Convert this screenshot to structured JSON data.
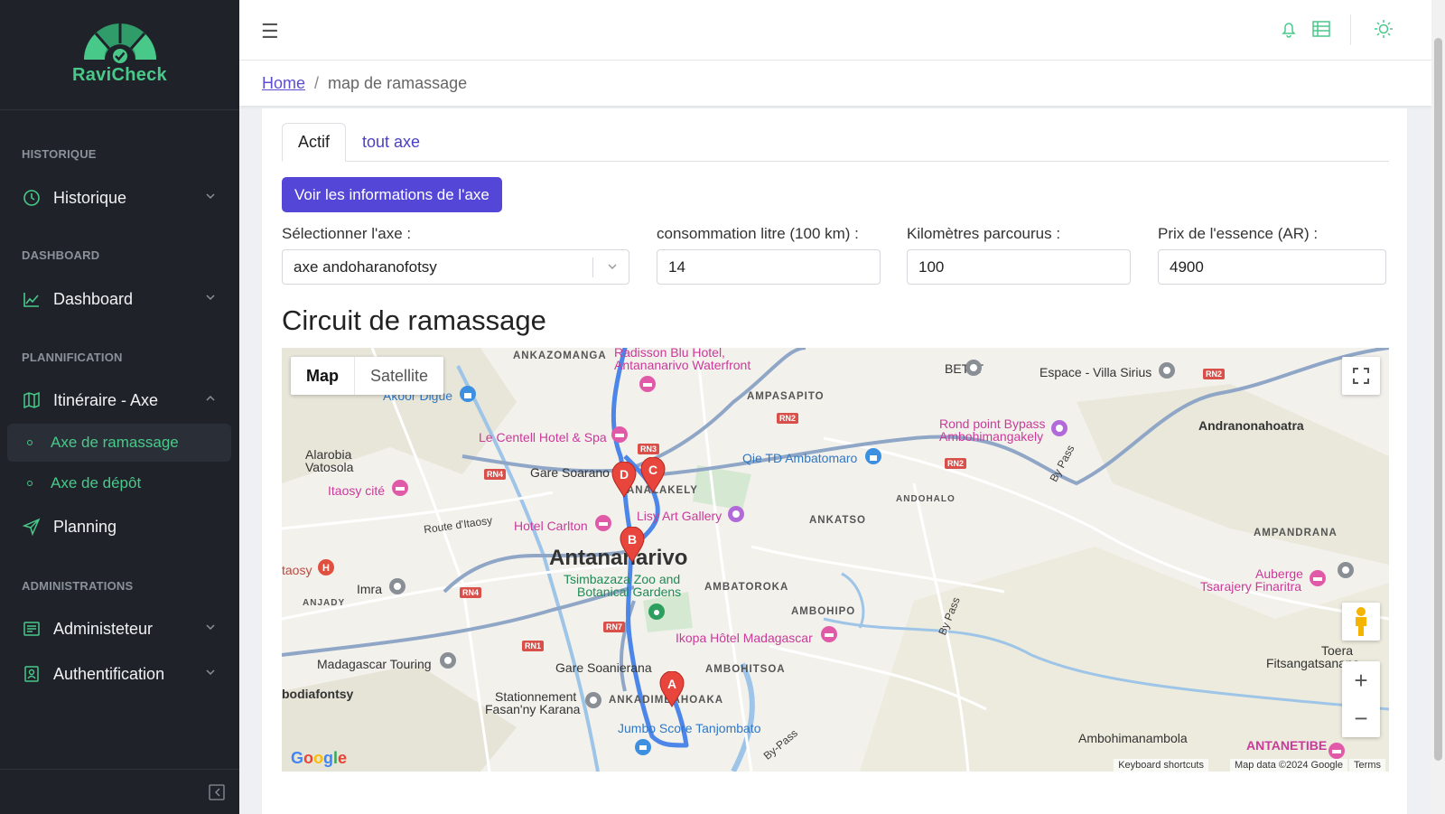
{
  "app": {
    "name": "RaviCheck",
    "brand_color": "#48c98a",
    "accent_color": "#5446d6"
  },
  "sidebar": {
    "sections": [
      {
        "title": "HISTORIQUE",
        "items": [
          {
            "label": "Historique",
            "icon": "history-icon",
            "expanded": false
          }
        ]
      },
      {
        "title": "DASHBOARD",
        "items": [
          {
            "label": "Dashboard",
            "icon": "chart-line-icon",
            "expanded": false
          }
        ]
      },
      {
        "title": "PLANNIFICATION",
        "items": [
          {
            "label": "Itinéraire - Axe",
            "icon": "map-icon",
            "expanded": true,
            "children": [
              {
                "label": "Axe de ramassage",
                "active": true
              },
              {
                "label": "Axe de dépôt",
                "active": false
              }
            ]
          },
          {
            "label": "Planning",
            "icon": "send-icon"
          }
        ]
      },
      {
        "title": "ADMINISTRATIONS",
        "items": [
          {
            "label": "Administeteur",
            "icon": "list-icon",
            "expanded": false
          },
          {
            "label": "Authentification",
            "icon": "user-doc-icon",
            "expanded": false
          }
        ]
      }
    ]
  },
  "header": {
    "icons": [
      "menu-icon",
      "bell-icon",
      "table-icon",
      "sun-icon"
    ]
  },
  "breadcrumb": {
    "home": "Home",
    "separator": "/",
    "current": "map de ramassage"
  },
  "tabs": [
    {
      "label": "Actif",
      "active": true
    },
    {
      "label": "tout axe",
      "active": false
    }
  ],
  "main": {
    "info_button": "Voir les informations de l'axe",
    "fields": {
      "axe": {
        "label": "Sélectionner l'axe :",
        "value": "axe andoharanofotsy"
      },
      "consommation": {
        "label": "consommation litre (100 km) :",
        "value": "14"
      },
      "kilometres": {
        "label": "Kilomètres parcourus :",
        "value": "100"
      },
      "prix": {
        "label": "Prix de l'essence (AR) :",
        "value": "4900"
      }
    },
    "section_title": "Circuit de ramassage"
  },
  "map": {
    "type_options": [
      "Map",
      "Satellite"
    ],
    "selected_type": "Map",
    "labels": {
      "ankazomanga": "ANKAZOMANGA",
      "radisson": "Radisson Blu Hotel,",
      "radisson2": "Antananarivo Waterfront",
      "akoor": "Akoor Digue",
      "betat": "BETAT",
      "espace": "Espace - Villa Sirius",
      "ampasapito": "AMPASAPITO",
      "rondpoint1": "Rond point Bypass",
      "rondpoint2": "Ambohimangakely",
      "andranona": "Andranonahoatra",
      "centell": "Le Centell Hotel & Spa",
      "alarobia1": "Alarobia",
      "alarobia2": "Vatosola",
      "garesoarano": "Gare Soarano",
      "analakely": "ANALAKELY",
      "qie": "Qie TD Ambatomaro",
      "andohalo": "ANDOHALO",
      "itaosy": "Itaosy cité",
      "routeitaosy": "Route d'Itaosy",
      "hotelcarlton": "Hotel Carlton",
      "lisy": "Lisy Art Gallery",
      "ankatso": "ANKATSO",
      "ampandrana": "AMPANDRANA",
      "city": "Antananarivo",
      "taosy": "taosy",
      "tsimbazaza1": "Tsimbazaza Zoo and",
      "tsimbazaza2": "Botanical Gardens",
      "ambatoroka": "AMBATOROKA",
      "auberge1": "Auberge",
      "auberge2": "Tsarajery Finaritra",
      "imra": "Imra",
      "anjady": "ANJADY",
      "ambohipo": "AMBOHIPO",
      "ikopa": "Ikopa Hôtel Madagascar",
      "bypass1": "By Pass",
      "madagascartouring": "Madagascar Touring",
      "garesoanierana": "Gare Soanierana",
      "ambohitsoa": "AMBOHITSOA",
      "toera": "Toera",
      "fitsangatsanana": "Fitsangatsanana",
      "bodiafontsy": "bodiafontsy",
      "stationnement1": "Stationnement",
      "stationnement2": "Fasan'ny Karana",
      "ankadimbahoaka": "ANKADIMBAHOAKA",
      "jumbo": "Jumbo Score Tanjombato",
      "ambohimanambola": "Ambohimanambola",
      "antanetibe": "ANTANETIBE",
      "bypass2": "By Pass",
      "bypass3": "By-Pass"
    },
    "road_badges": [
      "RN2",
      "RN2",
      "RN3",
      "RN4",
      "RN2",
      "RN4",
      "RN7",
      "RN1"
    ],
    "markers": [
      "A",
      "B",
      "C",
      "D"
    ],
    "attribution": {
      "shortcuts": "Keyboard shortcuts",
      "data": "Map data ©2024 Google",
      "terms": "Terms"
    },
    "google": "Google"
  }
}
